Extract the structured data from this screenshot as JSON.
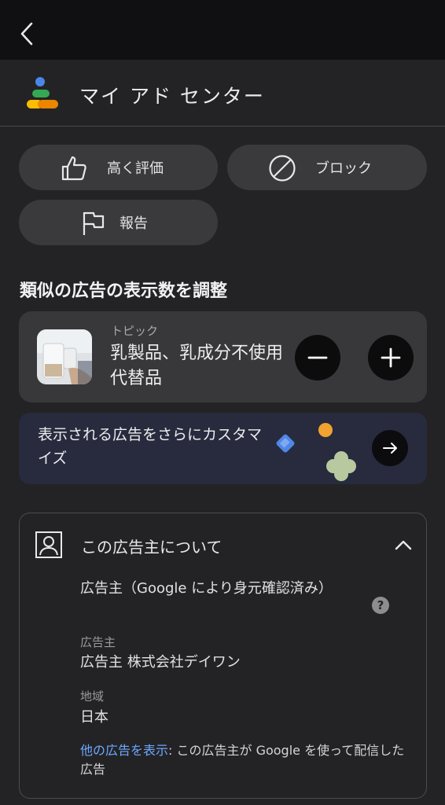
{
  "topbar": {
    "back_icon": "chevron-left-icon"
  },
  "header": {
    "title": "マイ アド センター",
    "logo_icon": "my-ad-center-logo"
  },
  "actions": {
    "like_label": "高く評価",
    "block_label": "ブロック",
    "report_label": "報告"
  },
  "adjust": {
    "title": "類似の広告の表示数を調整",
    "topic_small": "トピック",
    "topic_name": "乳製品、乳成分不使用代替品",
    "minus_icon": "minus-icon",
    "plus_icon": "plus-icon"
  },
  "promo": {
    "text": "表示される広告をさらにカスタマイズ",
    "arrow_icon": "arrow-right-icon"
  },
  "about": {
    "title": "この広告主について",
    "verified_label": "広告主（Google により身元確認済み）",
    "advertiser_label": "広告主",
    "advertiser_value": "広告主 株式会社デイワン",
    "region_label": "地域",
    "region_value": "日本",
    "link_text": "他の広告を表示",
    "link_suffix": ": この広告主が Google を使って配信した広告",
    "help_mark": "?"
  },
  "colors": {
    "background": "#232325",
    "card": "#38383b",
    "promo": "#272b3d",
    "link": "#6ea8ff"
  }
}
